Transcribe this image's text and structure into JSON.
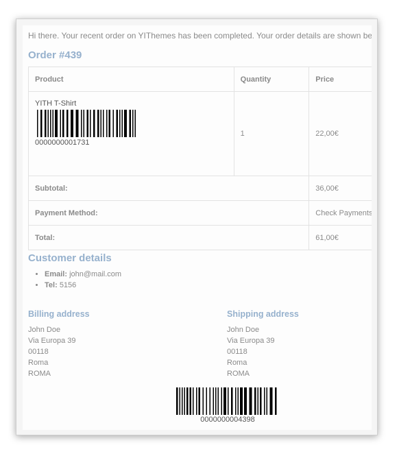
{
  "email": {
    "intro": "Hi there. Your recent order on YIThemes has been completed. Your order details are shown below for your reference:",
    "order_title": "Order #439",
    "table": {
      "headers": {
        "product": "Product",
        "quantity": "Quantity",
        "price": "Price"
      },
      "items": [
        {
          "name": "YITH T-Shirt",
          "sku": "0000000001731",
          "quantity": "1",
          "price": "22,00€"
        }
      ],
      "totals": [
        {
          "label": "Subtotal:",
          "value": "36,00€"
        },
        {
          "label": "Payment Method:",
          "value": "Check Payments"
        },
        {
          "label": "Total:",
          "value": "61,00€"
        }
      ]
    },
    "customer": {
      "title": "Customer details",
      "email_label": "Email:",
      "email_value": "john@mail.com",
      "tel_label": "Tel:",
      "tel_value": "5156"
    },
    "billing": {
      "title": "Billing address",
      "lines": [
        "John Doe",
        "Via Europa 39",
        "00118",
        "Roma",
        "ROMA"
      ]
    },
    "shipping": {
      "title": "Shipping address",
      "lines": [
        "John Doe",
        "Via Europa 39",
        "00118",
        "Roma",
        "ROMA"
      ]
    },
    "order_barcode": "0000000004398"
  },
  "colors": {
    "heading": "#96b1cd",
    "text": "#8a8a8a",
    "border": "#e2e2e2"
  },
  "icons": {
    "product_barcode": "barcode-icon",
    "order_barcode": "barcode-icon"
  }
}
